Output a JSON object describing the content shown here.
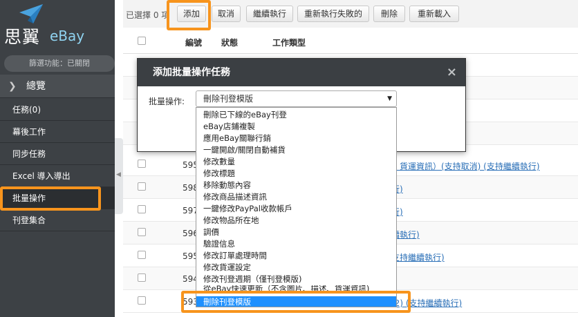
{
  "brand": {
    "cn": "思翼",
    "en": "eBay"
  },
  "sidebar": {
    "filter_status": "篩選功能：已關閉",
    "overview": "總覽",
    "items": [
      {
        "label": "任務(0)"
      },
      {
        "label": "幕後工作"
      },
      {
        "label": "同步任務"
      },
      {
        "label": "Excel 導入導出"
      },
      {
        "label": "批量操作"
      },
      {
        "label": "刊登集合"
      }
    ]
  },
  "toolbar": {
    "selected_count": "已選擇 0 項",
    "buttons": {
      "add": "添加",
      "cancel": "取消",
      "resume": "繼續執行",
      "rerun_failed": "重新執行失敗的",
      "delete": "刪除",
      "reload": "重新載入"
    }
  },
  "table": {
    "headers": {
      "id": "編號",
      "status": "狀態",
      "type": "工作類型"
    },
    "rows": [
      {
        "id": "595",
        "link": "、貨運資訊）(支持取消) (支持繼續執行)"
      },
      {
        "id": "598",
        "link": "行)"
      },
      {
        "id": "597",
        "link": "行)"
      },
      {
        "id": "596",
        "link": "續執行)"
      },
      {
        "id": "595",
        "link": "支持繼續執行)"
      },
      {
        "id": "594",
        "link": ""
      },
      {
        "id": "593",
        "link": "(2) (支持繼續執行)"
      }
    ]
  },
  "modal": {
    "title": "添加批量操作任務",
    "close_symbol": "×",
    "field_label": "批量操作:",
    "selected_value": "刪除刊登模版",
    "caret": "▼"
  },
  "dropdown": {
    "options": [
      "刪除已下線的eBay刊登",
      "eBay店鋪複製",
      "應用eBay關聯行銷",
      "一鍵開啟/關閉自動補貨",
      "修改數量",
      "修改標題",
      "移除動態內容",
      "修改商品描述資訊",
      "一鍵修改PayPal收款帳戶",
      "修改物品所在地",
      "調價",
      "驗證信息",
      "修改訂單處理時間",
      "修改貨運設定",
      "修改刊登週期（僅刊登模版)",
      "從eBay快速更新（不含圖片、描述、貨運資訊)",
      "刪除刊登模版"
    ],
    "selected_index": 16
  },
  "colors": {
    "sidebar_bg": "#3d4145",
    "modal_header_bg": "#3b3f43",
    "highlight": "#f7941d",
    "selected_option": "#1e90ff",
    "link": "#2a6fb7"
  }
}
